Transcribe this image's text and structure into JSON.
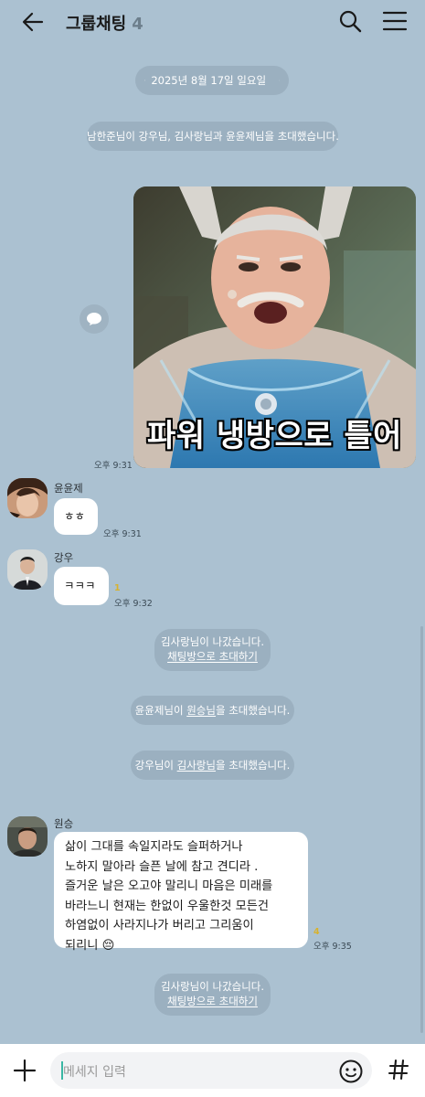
{
  "header": {
    "title": "그룹채팅",
    "member_count": "4",
    "icons": [
      "back-arrow-icon",
      "search-icon",
      "menu-icon"
    ]
  },
  "date_divider": "2025년 8월 17일 일요일",
  "notices": {
    "invite1": "남한준님이 강우님, 김사랑님과 윤윤제님을 초대했습니다.",
    "left1_line1": "김사랑님이 나갔습니다.",
    "left1_link": "채팅방으로 초대하기",
    "invite2_prefix": "윤윤제님이 ",
    "invite2_name": "원승님",
    "invite2_suffix": "을 초대했습니다.",
    "invite3_prefix": "강우님이 ",
    "invite3_name": "김사랑님",
    "invite3_suffix": "을 초대했습니다.",
    "left2_line1": "김사랑님이 나갔습니다.",
    "left2_link": "채팅방으로 초대하기"
  },
  "messages": {
    "photo": {
      "caption": "파워 냉방으로 틀어",
      "time": "오후 9:31"
    },
    "m1": {
      "sender": "윤윤제",
      "text": "ㅎㅎ",
      "time": "오후 9:31"
    },
    "m2": {
      "sender": "강우",
      "text": "ㅋㅋㅋ",
      "unread": "1",
      "time": "오후 9:32"
    },
    "m3": {
      "sender": "원승",
      "lines": [
        "삶이 그대를 속일지라도 슬퍼하거나",
        "노하지 말아라 슬픈 날에 참고 견디라 .",
        "즐거운 날은 오고야 말리니 마음은 미래를",
        "바라느니 현재는 한없이 우울한것 모든건",
        "하염없이 사라지나가 버리고 그리움이",
        "되리니 😔"
      ],
      "unread": "4",
      "time": "오후 9:35"
    }
  },
  "composer": {
    "placeholder": "메세지 입력"
  },
  "colors": {
    "background": "#abc1d1",
    "pill": "#9bb0c0",
    "unread": "#d8b22e"
  }
}
